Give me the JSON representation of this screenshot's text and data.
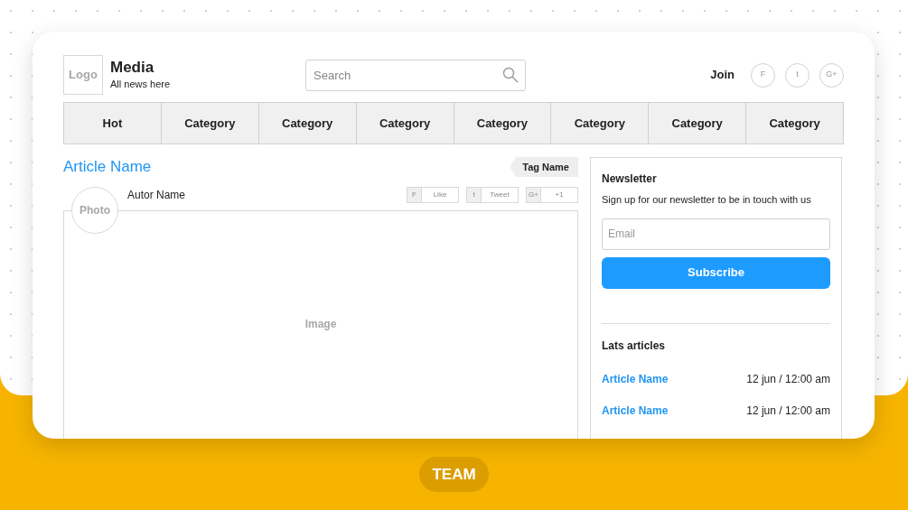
{
  "logo": "Logo",
  "site": {
    "name": "Media",
    "tagline": "All news here"
  },
  "search": {
    "placeholder": "Search"
  },
  "join": "Join",
  "social": [
    "F",
    "t",
    "G+"
  ],
  "nav": [
    "Hot",
    "Category",
    "Category",
    "Category",
    "Category",
    "Category",
    "Category",
    "Category"
  ],
  "article": {
    "title": "Article Name",
    "tag": "Tag Name",
    "photo": "Photo",
    "author": "Autor Name",
    "image": "Image",
    "shares": [
      {
        "icon": "F",
        "label": "Like"
      },
      {
        "icon": "t",
        "label": "Tweet"
      },
      {
        "icon": "G+",
        "label": "+1"
      }
    ]
  },
  "newsletter": {
    "title": "Newsletter",
    "text": "Sign up for our newsletter to be in touch with us",
    "email_placeholder": "Email",
    "button": "Subscribe"
  },
  "latest": {
    "title": "Lats articles",
    "items": [
      {
        "name": "Article Name",
        "time": "12 jun / 12:00 am"
      },
      {
        "name": "Article Name",
        "time": "12 jun / 12:00 am"
      }
    ]
  },
  "badge": "TEAM"
}
